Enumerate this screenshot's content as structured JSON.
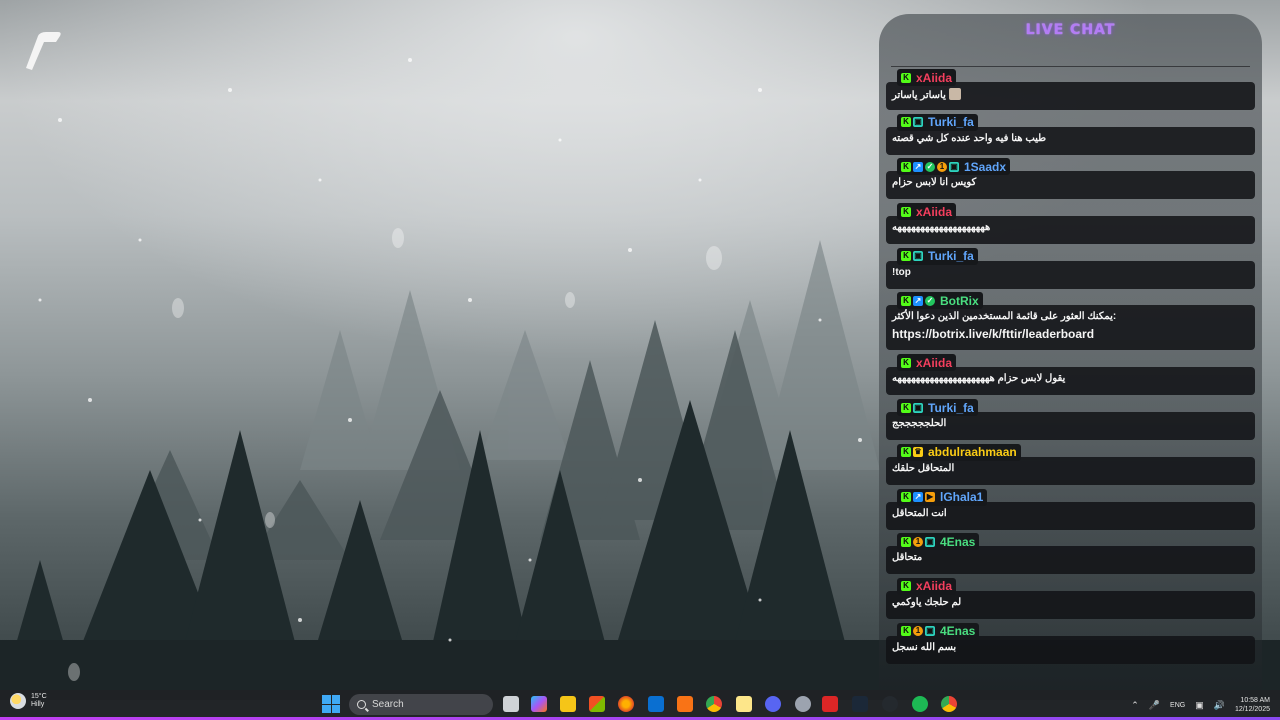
{
  "chat": {
    "title": "LIVE CHAT",
    "messages": [
      {
        "username": "xAiida",
        "color": "#f43f5e",
        "badges": [
          "kick-icon"
        ],
        "text": "ياساتر ياساتر",
        "emote": "emote-icon"
      },
      {
        "username": "Turki_fa",
        "color": "#60a5fa",
        "badges": [
          "kick-icon",
          "subscriber-icon"
        ],
        "text": "طيب هنا فيه واحد عنده كل شي قصته"
      },
      {
        "username": "1Saadx",
        "color": "#60a5fa",
        "badges": [
          "kick-icon",
          "moderator-icon",
          "verified-icon",
          "og-icon",
          "subscriber-icon"
        ],
        "text": "كويس انا لابس حزام"
      },
      {
        "username": "xAiida",
        "color": "#f43f5e",
        "badges": [
          "kick-icon"
        ],
        "text": "ههههههههههههههههههههه"
      },
      {
        "username": "Turki_fa",
        "color": "#60a5fa",
        "badges": [
          "kick-icon",
          "subscriber-icon"
        ],
        "text": "!top"
      },
      {
        "username": "BotRix",
        "color": "#4ade80",
        "badges": [
          "kick-icon",
          "moderator-icon",
          "verified-icon"
        ],
        "text": "يمكنك العثور على قائمة المستخدمين الذين دعوا الأكثر:",
        "text2": "https://botrix.live/k/fttir/leaderboard"
      },
      {
        "username": "xAiida",
        "color": "#f43f5e",
        "badges": [
          "kick-icon"
        ],
        "text": "يقول لابس حزام هههههههههههههههههههههه"
      },
      {
        "username": "Turki_fa",
        "color": "#60a5fa",
        "badges": [
          "kick-icon",
          "subscriber-icon"
        ],
        "text": "الحلجججججج"
      },
      {
        "username": "abdulraahmaan",
        "color": "#facc15",
        "badges": [
          "kick-icon",
          "crown-icon"
        ],
        "text": "المتحاقل حلقك"
      },
      {
        "username": "lGhala1",
        "color": "#60a5fa",
        "badges": [
          "kick-icon",
          "moderator-icon",
          "flag-icon"
        ],
        "text": "انت المتحاقل"
      },
      {
        "username": "4Enas",
        "color": "#4ade80",
        "badges": [
          "kick-icon",
          "og-icon",
          "subscriber-icon"
        ],
        "text": "متحاقل"
      },
      {
        "username": "xAiida",
        "color": "#f43f5e",
        "badges": [
          "kick-icon"
        ],
        "text": "لم حلجك ياوكمي"
      },
      {
        "username": "4Enas",
        "color": "#4ade80",
        "badges": [
          "kick-icon",
          "og-icon",
          "subscriber-icon"
        ],
        "text": "بسم الله نسجل"
      }
    ]
  },
  "taskbar": {
    "weather_temp": "15°C",
    "weather_desc": "Hilly",
    "search_placeholder": "Search",
    "language": "ENG",
    "time": "10:58 AM",
    "date": "12/12/2025",
    "accent_color": "#c040f0",
    "apps": [
      "file-viewer-icon",
      "copilot-icon",
      "file-explorer-icon",
      "store-icon",
      "firefox-icon",
      "outlook-icon",
      "app-a-icon",
      "chrome-icon",
      "notes-icon",
      "discord-icon",
      "settings-icon",
      "kick-studio-icon",
      "steam-icon",
      "github-icon",
      "spotify-icon",
      "chrome-alt-icon"
    ],
    "tray": [
      "chevron-up-icon",
      "microphone-icon",
      "language-indicator",
      "display-icon",
      "volume-icon",
      "clock"
    ]
  }
}
